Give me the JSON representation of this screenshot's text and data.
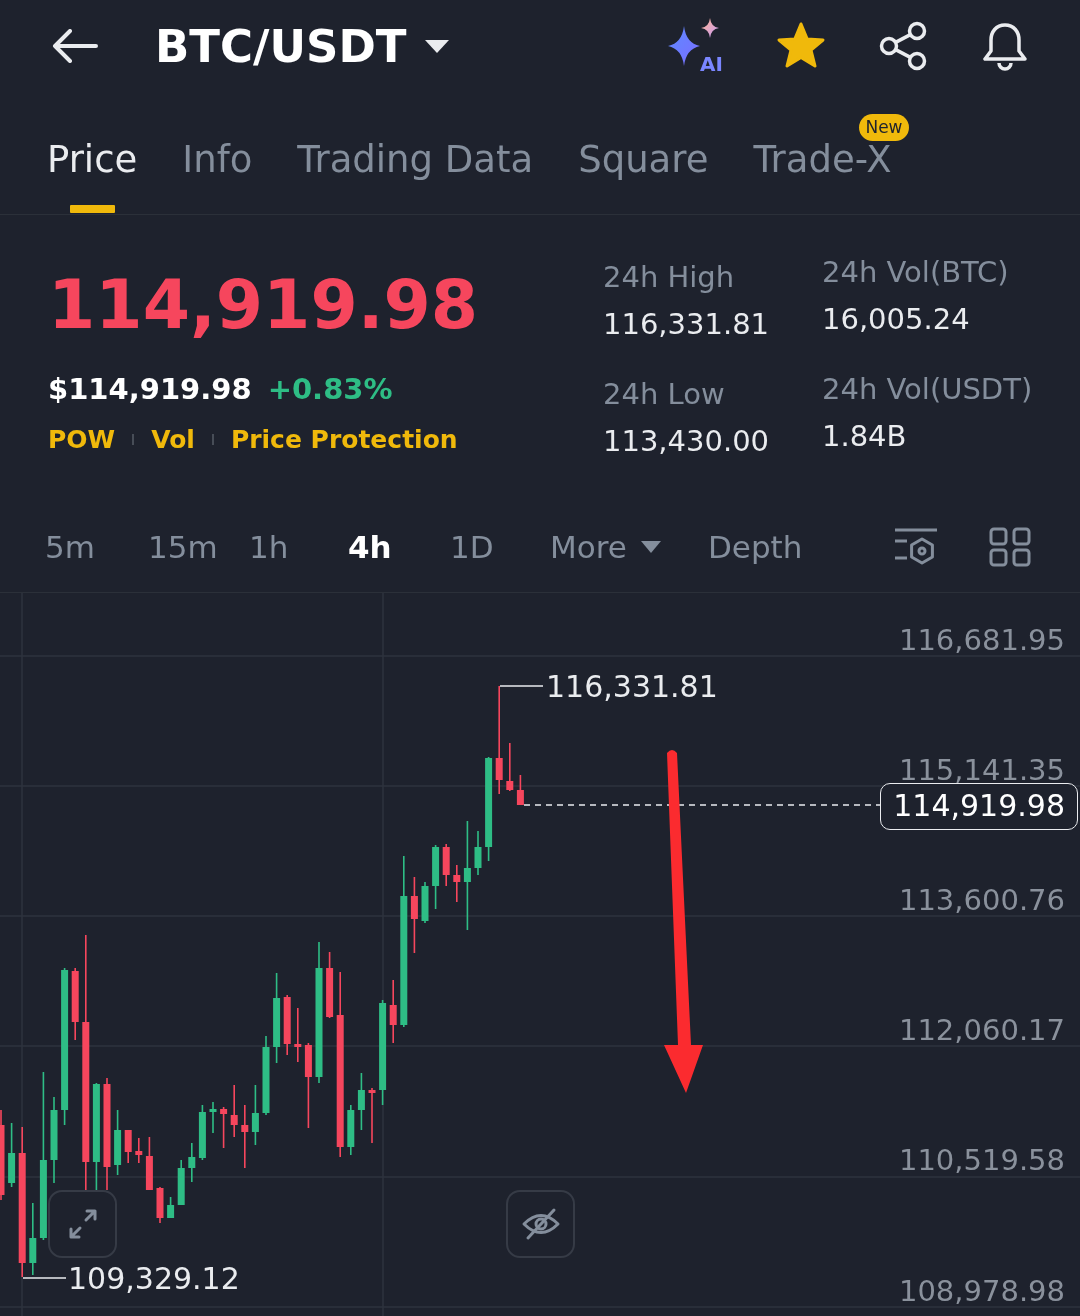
{
  "header": {
    "title": "BTC/USDT",
    "ai_label": "AI",
    "favorited": true
  },
  "tabs": [
    {
      "label": "Price",
      "selected": true
    },
    {
      "label": "Info",
      "selected": false
    },
    {
      "label": "Trading Data",
      "selected": false
    },
    {
      "label": "Square",
      "selected": false
    },
    {
      "label": "Trade-X",
      "selected": false,
      "badge": "New"
    }
  ],
  "ticker": {
    "last_price": "114,919.98",
    "last_price_falling": true,
    "usd_price": "$114,919.98",
    "change": "+0.83%",
    "change_rising": true,
    "tags": [
      "POW",
      "Vol",
      "Price Protection"
    ]
  },
  "stats_columns": [
    {
      "items": [
        {
          "label": "24h High",
          "value": "116,331.81"
        },
        {
          "label": "24h Low",
          "value": "113,430.00"
        }
      ]
    },
    {
      "items": [
        {
          "label": "24h Vol(BTC)",
          "value": "16,005.24"
        },
        {
          "label": "24h Vol(USDT)",
          "value": "1.84B"
        }
      ]
    }
  ],
  "intervals": [
    {
      "label": "5m",
      "kind": "option",
      "selected": false
    },
    {
      "label": "15m",
      "kind": "option",
      "selected": false
    },
    {
      "label": "1h",
      "kind": "option",
      "selected": false
    },
    {
      "label": "4h",
      "kind": "option",
      "selected": true
    },
    {
      "label": "1D",
      "kind": "option",
      "selected": false
    },
    {
      "label": "More",
      "kind": "dropdown",
      "selected": false
    },
    {
      "label": "Depth",
      "kind": "option",
      "selected": false
    }
  ],
  "chart": {
    "price_axis": [
      "116,681.95",
      "115,141.35",
      "113,600.76",
      "112,060.17",
      "110,519.58",
      "108,978.98"
    ],
    "high_marker": "116,331.81",
    "low_marker": "109,329.12",
    "current_price": "114,919.98"
  }
}
